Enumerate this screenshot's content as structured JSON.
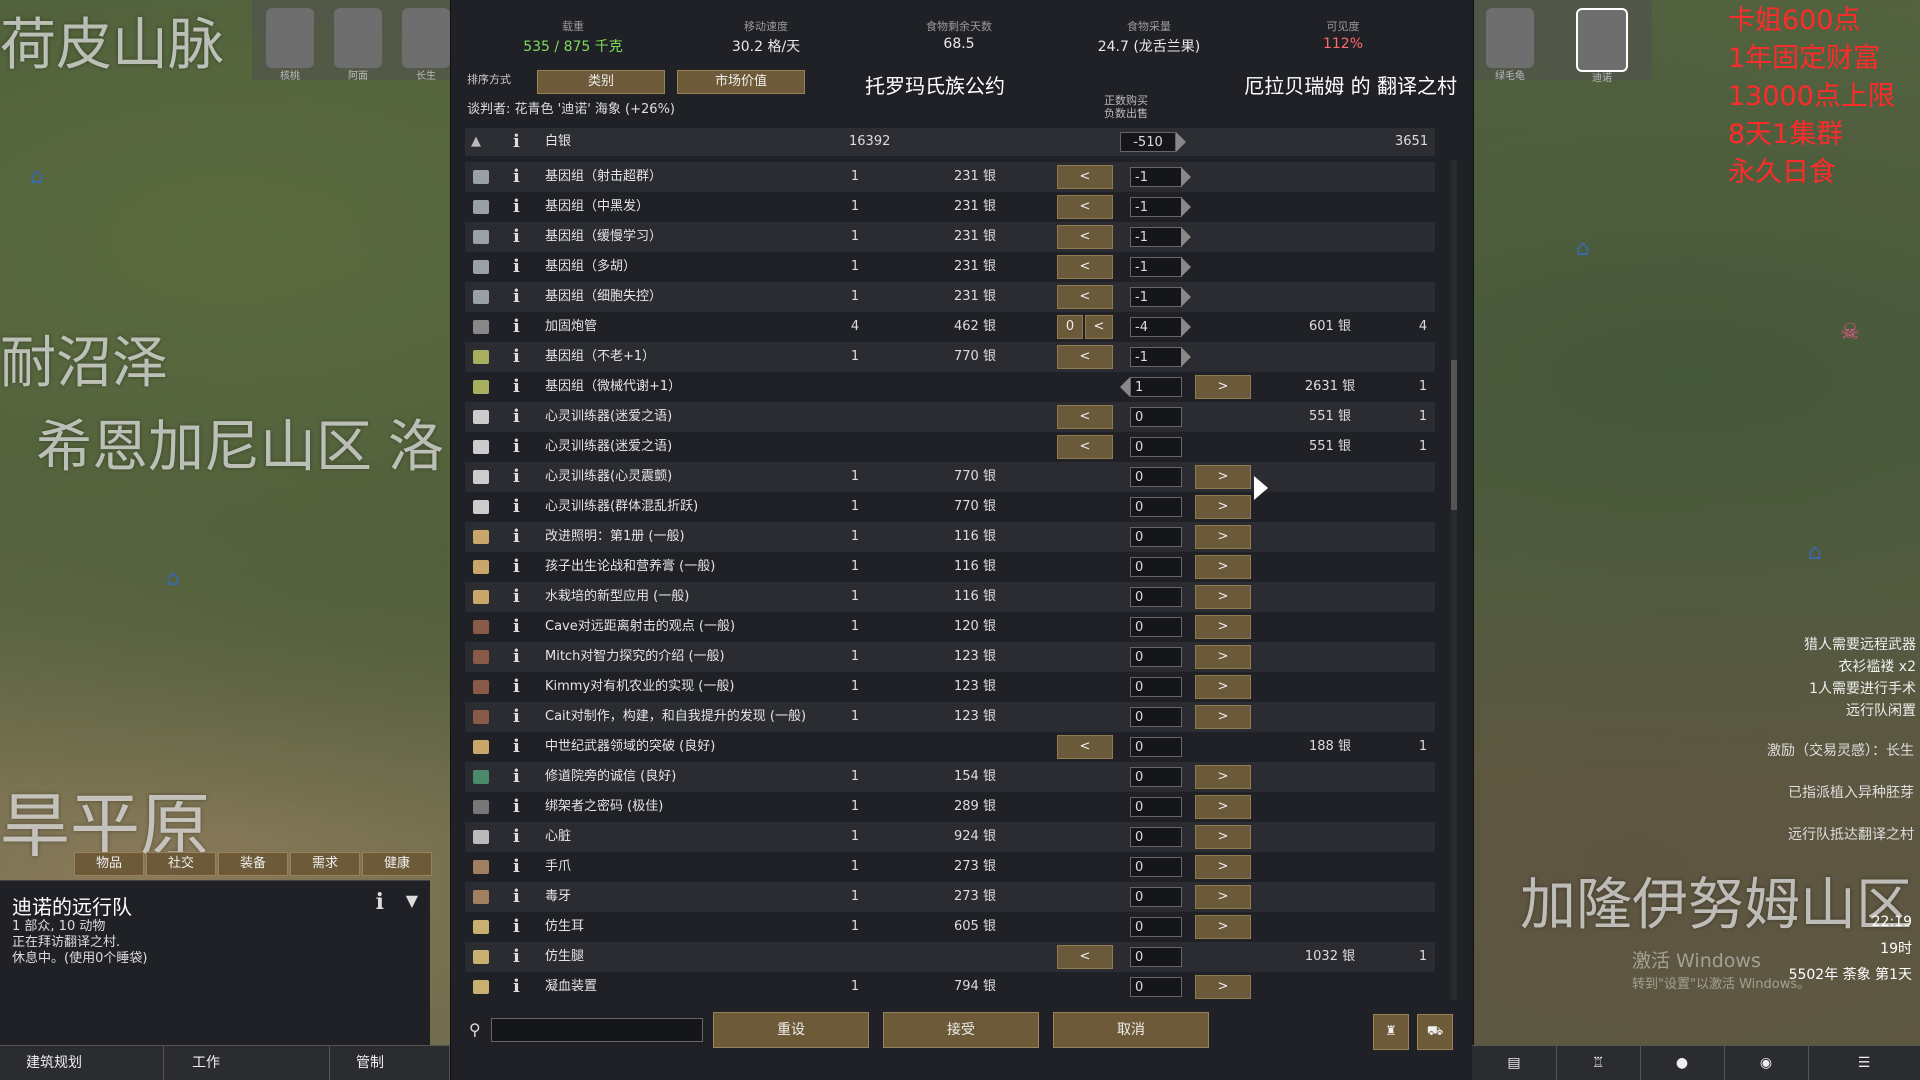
{
  "map": {
    "labels": [
      "荷皮山脉",
      "耐沼泽",
      "希恩加尼山区",
      "洛",
      "旱平原",
      "加隆伊努姆山区"
    ],
    "watermark_line1": "激活 Windows",
    "watermark_line2": "转到\"设置\"以激活 Windows。",
    "top_icon_labels": [
      "核桃",
      "阿面",
      "长生",
      "绿毛龟",
      "迪诺"
    ]
  },
  "overlay_text": [
    "卡姐600点",
    "1年固定财富",
    "13000点上限",
    "8天1集群",
    "永久日食"
  ],
  "alerts": [
    "猎人需要远程武器",
    "衣衫褴褛 x2",
    "1人需要进行手术",
    "远行队闲置"
  ],
  "alerts2": [
    "激励（交易灵感）：长生",
    "已指派植入异种胚芽",
    "远行队抵达翻译之村"
  ],
  "clock": {
    "time": "22:19",
    "hour": "19时",
    "date": "5502年 荼象 第1天"
  },
  "stats": [
    {
      "label": "载重",
      "value": "535 / 875 千克",
      "color": "#7fdc5a"
    },
    {
      "label": "移动速度",
      "value": "30.2 格/天",
      "color": "#e8e8e8"
    },
    {
      "label": "食物剩余天数",
      "value": "68.5",
      "color": "#e8e8e8"
    },
    {
      "label": "食物采量",
      "value": "24.7 (龙舌兰果)",
      "color": "#e8e8e8"
    },
    {
      "label": "可见度",
      "value": "112%",
      "color": "#ff6a6a"
    }
  ],
  "sort": {
    "label": "排序方式",
    "by1": "类别",
    "by2": "市场价值"
  },
  "faction_left": "托罗玛氏族公约",
  "faction_right": "厄拉贝瑞姆 的 翻译之村",
  "negotiator": "谈判者: 花青色 '迪诺' 海象 (+26%)",
  "note_line1": "正数购买",
  "note_line2": "负数出售",
  "silver": {
    "name": "白银",
    "colony": "16392",
    "field": "-510",
    "trader": "3651"
  },
  "rows": [
    {
      "name": "基因组（射击超群）",
      "qty": "1",
      "price": "231 银",
      "left": "<",
      "field": "-1",
      "right": "",
      "oprice": "",
      "oqty": "",
      "c": "#9aa0a8"
    },
    {
      "name": "基因组（中黑发）",
      "qty": "1",
      "price": "231 银",
      "left": "<",
      "field": "-1",
      "right": "",
      "oprice": "",
      "oqty": "",
      "c": "#9aa0a8"
    },
    {
      "name": "基因组（缓慢学习）",
      "qty": "1",
      "price": "231 银",
      "left": "<",
      "field": "-1",
      "right": "",
      "oprice": "",
      "oqty": "",
      "c": "#9aa0a8"
    },
    {
      "name": "基因组（多胡）",
      "qty": "1",
      "price": "231 银",
      "left": "<",
      "field": "-1",
      "right": "",
      "oprice": "",
      "oqty": "",
      "c": "#9aa0a8"
    },
    {
      "name": "基因组（细胞失控）",
      "qty": "1",
      "price": "231 银",
      "left": "<",
      "field": "-1",
      "right": "",
      "oprice": "",
      "oqty": "",
      "c": "#9aa0a8"
    },
    {
      "name": "加固炮管",
      "qty": "4",
      "price": "462 银",
      "left": "<",
      "lnum": "0",
      "field": "-4",
      "right": "",
      "oprice": "601 银",
      "oqty": "4",
      "c": "#888888"
    },
    {
      "name": "基因组（不老+1）",
      "qty": "1",
      "price": "770 银",
      "left": "<",
      "field": "-1",
      "right": "",
      "oprice": "",
      "oqty": "",
      "c": "#a8b060"
    },
    {
      "name": "基因组（微械代谢+1）",
      "qty": "",
      "price": "",
      "left": "",
      "field": "1",
      "right": ">",
      "oprice": "2631 银",
      "oqty": "1",
      "c": "#a8b060"
    },
    {
      "name": "心灵训练器(迷爱之语)",
      "qty": "",
      "price": "",
      "left": "<",
      "field": "0",
      "right": "",
      "oprice": "551 银",
      "oqty": "1",
      "c": "#cccccc"
    },
    {
      "name": "心灵训练器(迷爱之语)",
      "qty": "",
      "price": "",
      "left": "<",
      "field": "0",
      "right": "",
      "oprice": "551 银",
      "oqty": "1",
      "c": "#cccccc"
    },
    {
      "name": "心灵训练器(心灵震颤)",
      "qty": "1",
      "price": "770 银",
      "left": "",
      "field": "0",
      "right": ">",
      "oprice": "",
      "oqty": "",
      "c": "#cccccc"
    },
    {
      "name": "心灵训练器(群体混乱折跃)",
      "qty": "1",
      "price": "770 银",
      "left": "",
      "field": "0",
      "right": ">",
      "oprice": "",
      "oqty": "",
      "c": "#cccccc"
    },
    {
      "name": "改进照明：第1册 (一般)",
      "qty": "1",
      "price": "116 银",
      "left": "",
      "field": "0",
      "right": ">",
      "oprice": "",
      "oqty": "",
      "c": "#c9a66a"
    },
    {
      "name": "孩子出生论战和营养膏 (一般)",
      "qty": "1",
      "price": "116 银",
      "left": "",
      "field": "0",
      "right": ">",
      "oprice": "",
      "oqty": "",
      "c": "#c9a66a"
    },
    {
      "name": "水栽培的新型应用 (一般)",
      "qty": "1",
      "price": "116 银",
      "left": "",
      "field": "0",
      "right": ">",
      "oprice": "",
      "oqty": "",
      "c": "#c9a66a"
    },
    {
      "name": "Cave对远距离射击的观点 (一般)",
      "qty": "1",
      "price": "120 银",
      "left": "",
      "field": "0",
      "right": ">",
      "oprice": "",
      "oqty": "",
      "c": "#8a5a48"
    },
    {
      "name": "Mitch对智力探究的介绍 (一般)",
      "qty": "1",
      "price": "123 银",
      "left": "",
      "field": "0",
      "right": ">",
      "oprice": "",
      "oqty": "",
      "c": "#8a5a48"
    },
    {
      "name": "Kimmy对有机农业的实现 (一般)",
      "qty": "1",
      "price": "123 银",
      "left": "",
      "field": "0",
      "right": ">",
      "oprice": "",
      "oqty": "",
      "c": "#8a5a48"
    },
    {
      "name": "Cait对制作，构建，和自我提升的发现 (一般)",
      "qty": "1",
      "price": "123 银",
      "left": "",
      "field": "0",
      "right": ">",
      "oprice": "",
      "oqty": "",
      "c": "#8a5a48"
    },
    {
      "name": "中世纪武器领域的突破 (良好)",
      "qty": "",
      "price": "",
      "left": "<",
      "field": "0",
      "right": "",
      "oprice": "188 银",
      "oqty": "1",
      "c": "#c9a66a"
    },
    {
      "name": "修道院旁的诚信 (良好)",
      "qty": "1",
      "price": "154 银",
      "left": "",
      "field": "0",
      "right": ">",
      "oprice": "",
      "oqty": "",
      "c": "#4a8a6a"
    },
    {
      "name": "绑架者之密码 (极佳)",
      "qty": "1",
      "price": "289 银",
      "left": "",
      "field": "0",
      "right": ">",
      "oprice": "",
      "oqty": "",
      "c": "#777777"
    },
    {
      "name": "心脏",
      "qty": "1",
      "price": "924 银",
      "left": "",
      "field": "0",
      "right": ">",
      "oprice": "",
      "oqty": "",
      "c": "#bbbbbb"
    },
    {
      "name": "手爪",
      "qty": "1",
      "price": "273 银",
      "left": "",
      "field": "0",
      "right": ">",
      "oprice": "",
      "oqty": "",
      "c": "#a08060"
    },
    {
      "name": "毒牙",
      "qty": "1",
      "price": "273 银",
      "left": "",
      "field": "0",
      "right": ">",
      "oprice": "",
      "oqty": "",
      "c": "#a08060"
    },
    {
      "name": "仿生耳",
      "qty": "1",
      "price": "605 银",
      "left": "",
      "field": "0",
      "right": ">",
      "oprice": "",
      "oqty": "",
      "c": "#c8b070"
    },
    {
      "name": "仿生腿",
      "qty": "",
      "price": "",
      "left": "<",
      "field": "0",
      "right": "",
      "oprice": "1032 银",
      "oqty": "1",
      "c": "#c8b070"
    },
    {
      "name": "凝血装置",
      "qty": "1",
      "price": "794 银",
      "left": "",
      "field": "0",
      "right": ">",
      "oprice": "",
      "oqty": "",
      "c": "#c8b070"
    }
  ],
  "buttons": {
    "reset": "重设",
    "accept": "接受",
    "cancel": "取消"
  },
  "left_tabs": [
    "物品",
    "社交",
    "装备",
    "需求",
    "健康"
  ],
  "caravan": {
    "title": "迪诺的远行队",
    "line1": "1 部众, 10 动物",
    "line2": "正在拜访翻译之村.",
    "line3": "休息中。(使用0个睡袋)"
  },
  "bottom_bar": [
    "建筑规划",
    "工作",
    "管制"
  ]
}
